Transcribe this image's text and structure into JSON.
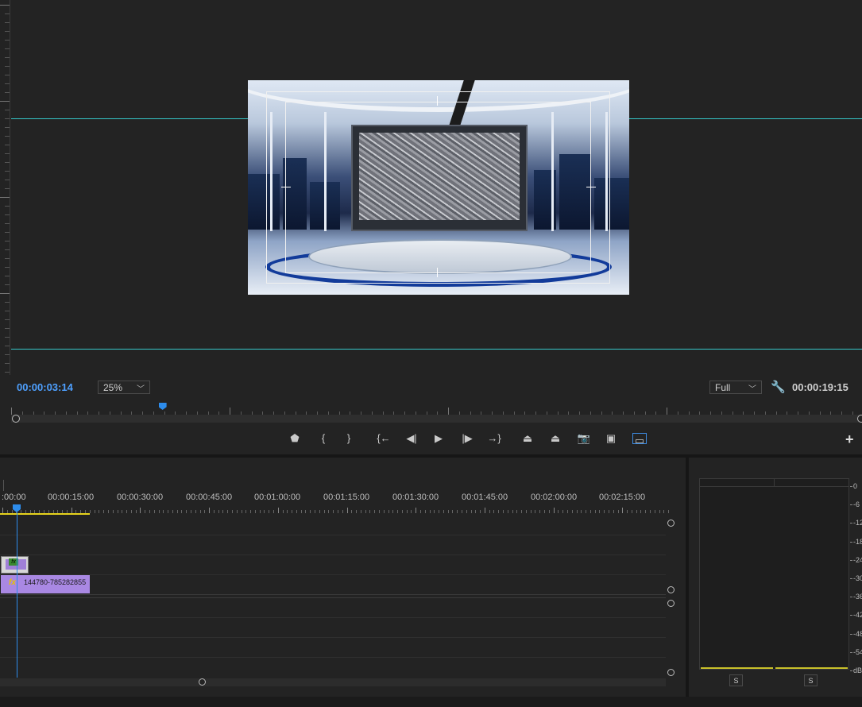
{
  "monitor": {
    "current_timecode": "00:00:03:14",
    "zoom_level": "25%",
    "resolution": "Full",
    "duration_timecode": "00:00:19:15",
    "playhead_fraction": 0.178
  },
  "transport": {
    "buttons": [
      {
        "name": "add-marker-button",
        "glyph": "⬟"
      },
      {
        "name": "mark-in-button",
        "glyph": "{"
      },
      {
        "name": "mark-out-button",
        "glyph": "}"
      },
      {
        "name": "go-to-in-button",
        "glyph": "{←"
      },
      {
        "name": "step-back-button",
        "glyph": "◀|"
      },
      {
        "name": "play-button",
        "glyph": "▶"
      },
      {
        "name": "step-forward-button",
        "glyph": "|▶"
      },
      {
        "name": "go-to-out-button",
        "glyph": "→}"
      },
      {
        "name": "lift-button",
        "glyph": "⏏"
      },
      {
        "name": "extract-button",
        "glyph": "⏏"
      },
      {
        "name": "export-frame-button",
        "glyph": "📷"
      },
      {
        "name": "comparison-view-button",
        "glyph": "▣"
      },
      {
        "name": "safe-margins-button",
        "glyph": "▭"
      }
    ],
    "add_button": "+"
  },
  "timeline": {
    "ruler_labels": [
      ":00:00",
      "00:00:15:00",
      "00:00:30:00",
      "00:00:45:00",
      "00:01:00:00",
      "00:01:15:00",
      "00:01:30:00",
      "00:01:45:00",
      "00:02:00:00",
      "00:02:15:00"
    ],
    "clips": {
      "v2": {
        "fx": "fx"
      },
      "v1": {
        "fx": "fx",
        "name": "144780-785282855"
      }
    }
  },
  "audio_meter": {
    "db_labels": [
      "0",
      "-6",
      "-12",
      "-18",
      "-24",
      "-30",
      "-36",
      "-42",
      "-48",
      "-54",
      "dB"
    ],
    "solo_left": "S",
    "solo_right": "S"
  },
  "colors": {
    "accent": "#2d8ceb",
    "guide": "#35c6c8",
    "clip": "#a988e3",
    "work_area": "#e6d21c"
  }
}
